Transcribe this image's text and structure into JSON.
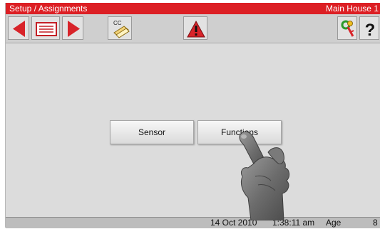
{
  "titlebar": {
    "breadcrumb": "Setup / Assignments",
    "location": "Main House 1"
  },
  "toolbar": {
    "buttons": [
      {
        "name": "back",
        "icon": "left-arrow-icon",
        "color": "#d8242a"
      },
      {
        "name": "history",
        "icon": "list-window-icon"
      },
      {
        "name": "forward",
        "icon": "right-arrow-icon",
        "color": "#d8242a"
      },
      {
        "name": "copy",
        "icon": "copy-document-icon",
        "label": "CC"
      },
      {
        "name": "alarm",
        "icon": "warning-triangle-icon",
        "color": "#d8242a"
      },
      {
        "name": "keys",
        "icon": "key-icon"
      },
      {
        "name": "help",
        "icon": "question-mark-icon",
        "label": "?"
      }
    ]
  },
  "main": {
    "buttons": [
      {
        "label": "Sensor"
      },
      {
        "label": "Functions"
      }
    ]
  },
  "statusbar": {
    "date": "14 Oct 2010",
    "time": "1:38:11 am",
    "age_label": "Age",
    "age_value": "8"
  },
  "colors": {
    "titlebar_bg": "#dc1f24",
    "screen_bg": "#dcdcdc"
  }
}
